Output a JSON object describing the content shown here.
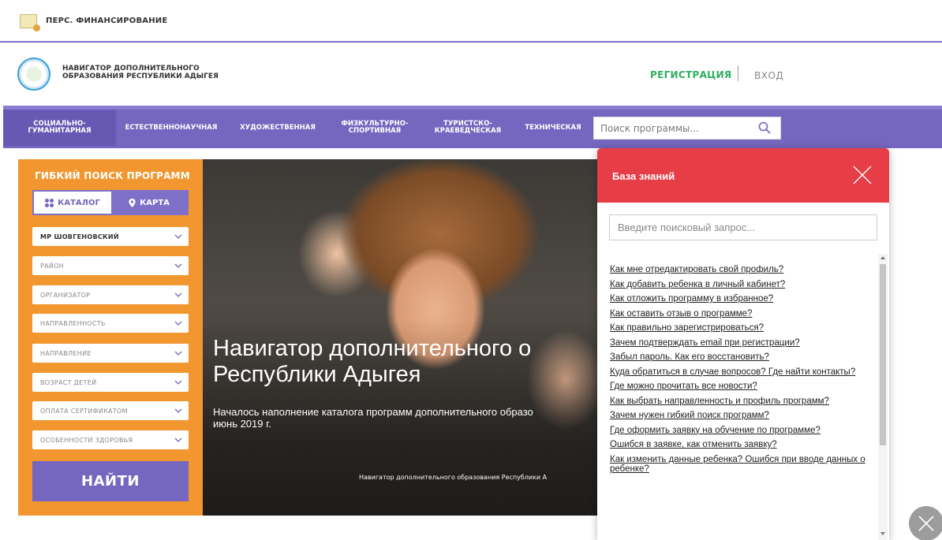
{
  "topbar": {
    "title": "ПЕРС. ФИНАНСИРОВАНИЕ"
  },
  "header": {
    "logo_line1": "НАВИГАТОР ДОПОЛНИТЕЛЬНОГО",
    "logo_line2": "ОБРАЗОВАНИЯ РЕСПУБЛИКИ АДЫГЕЯ",
    "register": "РЕГИСТРАЦИЯ",
    "login": "ВХОД"
  },
  "nav": {
    "items": [
      {
        "l1": "СОЦИАЛЬНО-",
        "l2": "ГУМАНИТАРНАЯ"
      },
      {
        "l1": "ЕСТЕСТВЕННОНАУЧНАЯ",
        "l2": ""
      },
      {
        "l1": "ХУДОЖЕСТВЕННАЯ",
        "l2": ""
      },
      {
        "l1": "ФИЗКУЛЬТУРНО-",
        "l2": "СПОРТИВНАЯ"
      },
      {
        "l1": "ТУРИСТСКО-",
        "l2": "КРАЕВЕДЧЕСКАЯ"
      },
      {
        "l1": "ТЕХНИЧЕСКАЯ",
        "l2": ""
      }
    ],
    "search_placeholder": "Поиск программы..."
  },
  "filter": {
    "title": "ГИБКИЙ ПОИСК ПРОГРАММ",
    "tab_catalog": "КАТАЛОГ",
    "tab_map": "КАРТА",
    "dropdowns": [
      "МР ШОВГЕНОВСКИЙ",
      "РАЙОН",
      "ОРГАНИЗАТОР",
      "НАПРАВЛЕННОСТЬ",
      "НАПРАВЛЕНИЕ",
      "ВОЗРАСТ ДЕТЕЙ",
      "ОПЛАТА СЕРТИФИКАТОМ",
      "ОСОБЕННОСТИ ЗДОРОВЬЯ"
    ],
    "find": "НАЙТИ"
  },
  "hero": {
    "title_line1": "Навигатор дополнительного о",
    "title_line2": "Республики Адыгея",
    "sub_line1": "Началось наполнение каталога программ дополнительного образо",
    "sub_line2": "июнь 2019 г.",
    "caption": "Навигатор дополнительного образования Республики А"
  },
  "kb": {
    "title": "База знаний",
    "search_placeholder": "Введите поисковый запрос...",
    "links": [
      "Как мне отредактировать свой профиль?",
      "Как добавить ребенка в личный кабинет?",
      "Как отложить программу в избранное?",
      "Как оставить отзыв о программе?",
      "Как правильно зарегистрироваться?",
      "Зачем подтверждать email при регистрации?",
      "Забыл пароль. Как его восстановить?",
      "Куда обратиться в случае вопросов? Где найти контакты?",
      "Где можно прочитать все новости?",
      "Как выбрать направленность и профиль программ?",
      "Зачем нужен гибкий поиск программ?",
      "Где оформить заявку на обучение по программе?",
      "Ошибся в заявке, как отменить заявку?",
      "Как изменить данные ребенка? Ошибся при вводе данных о ребенке?"
    ]
  }
}
